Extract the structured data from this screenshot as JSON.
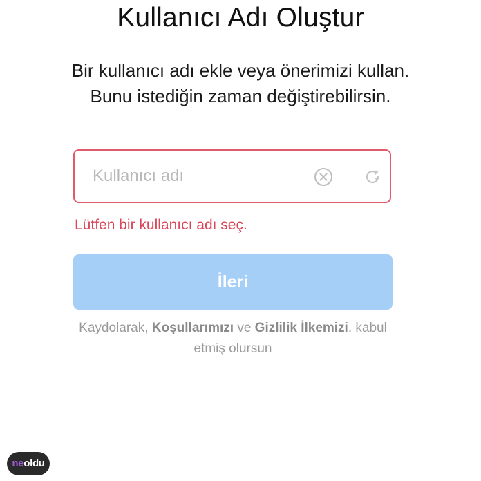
{
  "header": {
    "title": "Kullanıcı Adı Oluştur"
  },
  "intro": {
    "text": "Bir kullanıcı adı ekle veya önerimizi kullan. Bunu istediğin zaman değiştirebilirsin."
  },
  "username_field": {
    "value": "",
    "placeholder": "Kullanıcı adı",
    "clear_icon": "clear-circle-x-icon",
    "refresh_icon": "refresh-arrow-icon",
    "border_color": "#e05b6a"
  },
  "error": {
    "text": "Lütfen bir kullanıcı adı seç.",
    "color": "#d94658"
  },
  "next_button": {
    "label": "İleri",
    "background": "#a6cff8"
  },
  "terms": {
    "prefix": "Kaydolarak,",
    "terms_link": "Koşullarımızı",
    "middle": "ve",
    "privacy_link": "Gizlilik İlkemizi",
    "suffix": ". kabul etmiş olursun"
  },
  "watermark": {
    "prefix": "ne",
    "suffix": "oldu"
  }
}
